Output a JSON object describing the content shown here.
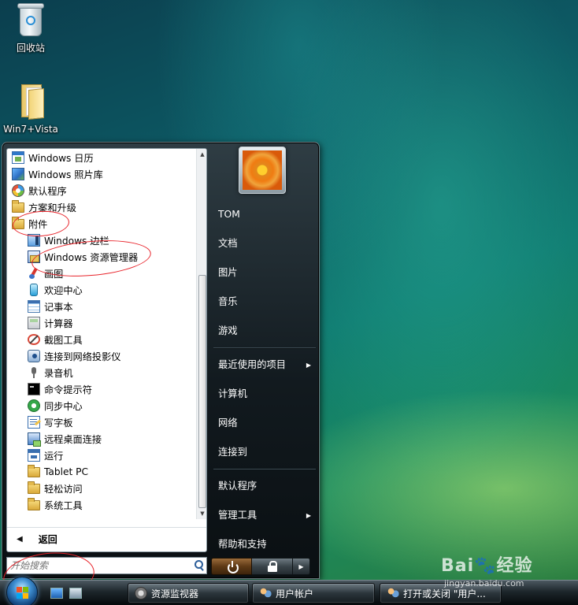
{
  "desktop": {
    "icons": [
      {
        "label": "回收站",
        "icon": "recycle-bin-icon"
      },
      {
        "label": "Win7+Vista",
        "icon": "folder-icon"
      }
    ]
  },
  "start_menu": {
    "programs": [
      {
        "label": "Windows 日历",
        "icon": "calendar-icon",
        "level": 0
      },
      {
        "label": "Windows 照片库",
        "icon": "photo-gallery-icon",
        "level": 0
      },
      {
        "label": "默认程序",
        "icon": "default-programs-icon",
        "level": 0
      },
      {
        "label": "方案和升级",
        "icon": "folder-icon",
        "level": 0
      },
      {
        "label": "附件",
        "icon": "folder-icon",
        "level": 0
      },
      {
        "label": "Windows 边栏",
        "icon": "sidebar-icon",
        "level": 1
      },
      {
        "label": "Windows 资源管理器",
        "icon": "explorer-icon",
        "level": 1
      },
      {
        "label": "画图",
        "icon": "paint-icon",
        "level": 1
      },
      {
        "label": "欢迎中心",
        "icon": "welcome-center-icon",
        "level": 1
      },
      {
        "label": "记事本",
        "icon": "notepad-icon",
        "level": 1
      },
      {
        "label": "计算器",
        "icon": "calculator-icon",
        "level": 1
      },
      {
        "label": "截图工具",
        "icon": "snipping-tool-icon",
        "level": 1
      },
      {
        "label": "连接到网络投影仪",
        "icon": "projector-icon",
        "level": 1
      },
      {
        "label": "录音机",
        "icon": "sound-recorder-icon",
        "level": 1
      },
      {
        "label": "命令提示符",
        "icon": "command-prompt-icon",
        "level": 1
      },
      {
        "label": "同步中心",
        "icon": "sync-center-icon",
        "level": 1
      },
      {
        "label": "写字板",
        "icon": "wordpad-icon",
        "level": 1
      },
      {
        "label": "远程桌面连接",
        "icon": "remote-desktop-icon",
        "level": 1
      },
      {
        "label": "运行",
        "icon": "run-icon",
        "level": 1
      },
      {
        "label": "Tablet PC",
        "icon": "folder-icon",
        "level": 1
      },
      {
        "label": "轻松访问",
        "icon": "folder-icon",
        "level": 1
      },
      {
        "label": "系统工具",
        "icon": "folder-icon",
        "level": 1
      }
    ],
    "back_label": "返回",
    "search_placeholder": "开始搜索",
    "right_items": [
      {
        "label": "TOM",
        "has_submenu": false
      },
      {
        "label": "文档",
        "has_submenu": false
      },
      {
        "label": "图片",
        "has_submenu": false
      },
      {
        "label": "音乐",
        "has_submenu": false
      },
      {
        "label": "游戏",
        "has_submenu": false
      },
      {
        "separator": true
      },
      {
        "label": "最近使用的项目",
        "has_submenu": true
      },
      {
        "label": "计算机",
        "has_submenu": false
      },
      {
        "label": "网络",
        "has_submenu": false
      },
      {
        "label": "连接到",
        "has_submenu": false
      },
      {
        "separator": true
      },
      {
        "label": "默认程序",
        "has_submenu": false
      },
      {
        "label": "管理工具",
        "has_submenu": true
      },
      {
        "label": "帮助和支持",
        "has_submenu": false
      }
    ],
    "submenu_glyph": "▶"
  },
  "taskbar": {
    "buttons": [
      {
        "label": "资源监视器",
        "icon": "resource-monitor-icon"
      },
      {
        "label": "用户帐户",
        "icon": "user-accounts-icon"
      },
      {
        "label": "打开或关闭 \"用户...",
        "icon": "user-accounts-icon"
      }
    ]
  },
  "watermark": {
    "logo": "Bai🐾经验",
    "url": "jingyan.baidu.com"
  },
  "colors": {
    "annotation": "#e8232a",
    "menu_dark": "#121a1f",
    "accent_blue": "#3f8fd2"
  }
}
